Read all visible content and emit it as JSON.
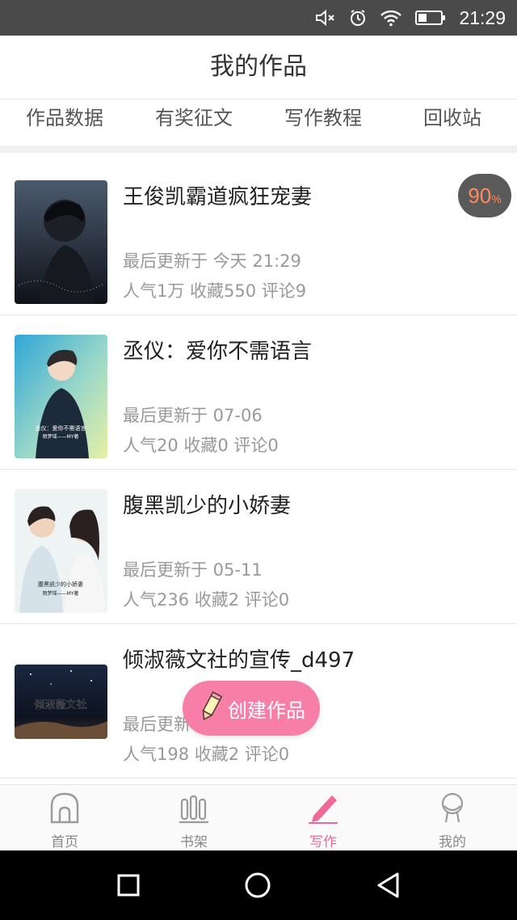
{
  "status_bar": {
    "time": "21:29",
    "icons": [
      "mute-icon",
      "alarm-icon",
      "wifi-icon",
      "battery-icon"
    ]
  },
  "header": {
    "title": "我的作品"
  },
  "tabs": [
    {
      "label": "作品数据"
    },
    {
      "label": "有奖征文"
    },
    {
      "label": "写作教程"
    },
    {
      "label": "回收站"
    }
  ],
  "works": [
    {
      "title": "王俊凯霸道疯狂宠妻",
      "updated": "最后更新于 今天 21:29",
      "stats": "人气1万  收藏550  评论9",
      "progress": {
        "value": "90",
        "unit": "%"
      }
    },
    {
      "title": "丞仪：爱你不需语言",
      "updated": "最后更新于 07-06",
      "stats": "人气20  收藏0  评论0",
      "cover_text": "丞仪：爱你不需语言 陌梦瑶——MY著"
    },
    {
      "title": "腹黑凯少的小娇妻",
      "updated": "最后更新于 05-11",
      "stats": "人气236  收藏2  评论0",
      "cover_text": "腹黑凯少的小娇妻 陌梦瑶——MY著"
    },
    {
      "title": "倾淑薇文社的宣传_d497",
      "updated": "最后更新于 05-03",
      "stats": "人气198  收藏2  评论0",
      "cover_text": "倾淑薇文社"
    }
  ],
  "create_button": {
    "label": "创建作品",
    "icon": "pencil-icon"
  },
  "bottom_nav": [
    {
      "label": "首页",
      "icon": "home-icon",
      "active": false
    },
    {
      "label": "书架",
      "icon": "bookshelf-icon",
      "active": false
    },
    {
      "label": "写作",
      "icon": "pen-icon",
      "active": true
    },
    {
      "label": "我的",
      "icon": "profile-icon",
      "active": false
    }
  ],
  "colors": {
    "accent": "#f0679a",
    "create_button": "#f77fa7",
    "badge_bg": "#5a5a5a",
    "badge_text": "#ff8a5c"
  }
}
